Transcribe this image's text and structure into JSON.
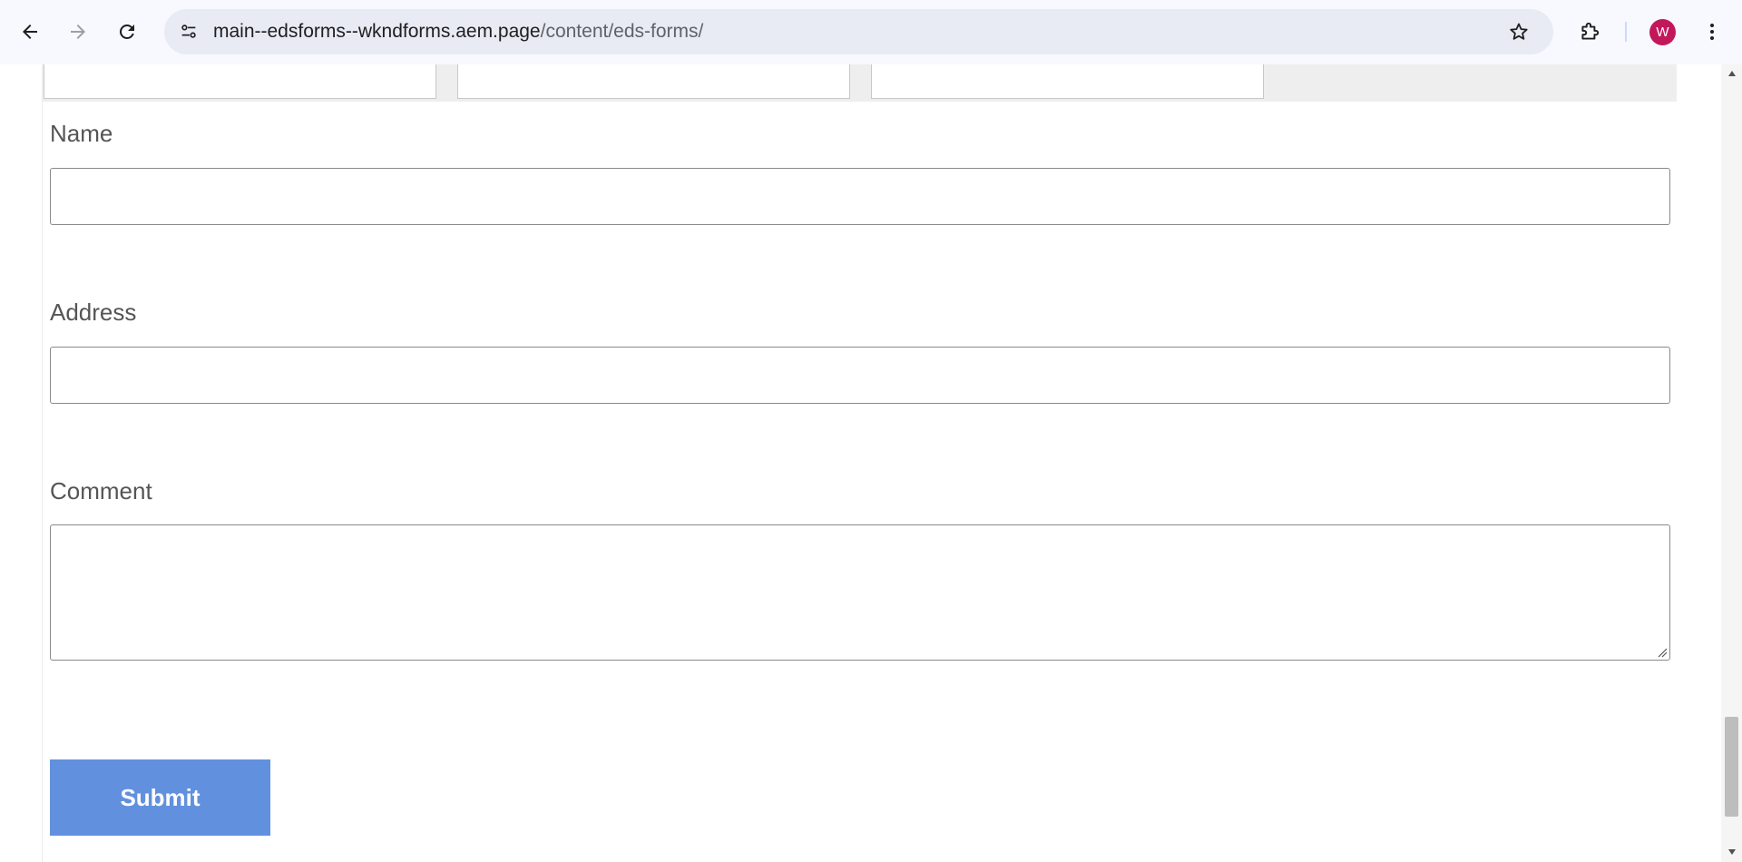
{
  "browser": {
    "url_host": "main--edsforms--wkndforms.aem.page",
    "url_path": "/content/eds-forms/",
    "profile_initial": "W",
    "profile_color": "#c2185b",
    "icons": {
      "back": "arrow-left-icon",
      "forward": "arrow-right-icon",
      "reload": "reload-icon",
      "site_info": "tune-icon",
      "bookmark": "star-outline-icon",
      "extensions": "puzzle-piece-icon",
      "menu": "kebab-menu-icon"
    }
  },
  "form": {
    "name_label": "Name",
    "name_value": "",
    "address_label": "Address",
    "address_value": "",
    "comment_label": "Comment",
    "comment_value": "",
    "submit_label": "Submit",
    "submit_color": "#6191de"
  }
}
